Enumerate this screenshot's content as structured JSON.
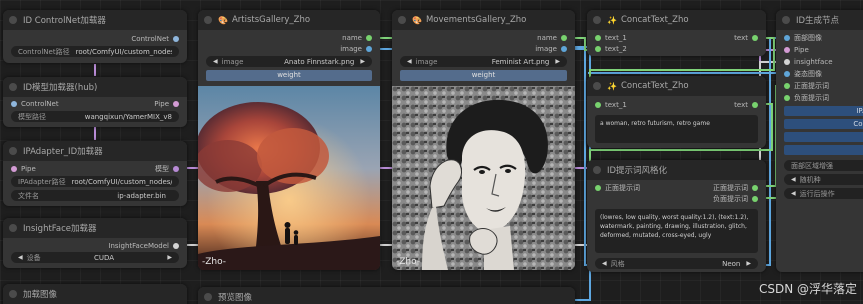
{
  "colors": {
    "port_controlnet": "#8fb6dc",
    "port_image": "#5fa5d8",
    "port_string": "#78d26e",
    "port_pipe": "#d39bd4",
    "port_model": "#e0c28a",
    "port_insightface": "#d4d4d4",
    "wire_blue": "#5ea7e0",
    "wire_green": "#7fd37a",
    "wire_purple": "#b88bd6"
  },
  "nodes": {
    "controlnet_loader": {
      "title": "ID ControlNet加载器",
      "output": "ControlNet",
      "path_label": "ControlNet路径",
      "path_value": "root/ComfyUI/custom_nodes/Com"
    },
    "model_loader": {
      "title": "ID模型加载器(hub)",
      "input": "ControlNet",
      "output": "Pipe",
      "path_label": "模型路径",
      "path_value": "wangqixun/YamerMIX_v8"
    },
    "ipadapter_loader": {
      "title": "IPAdapter_ID加载器",
      "input": "Pipe",
      "output": "模型",
      "path_label": "IPAdapter路径",
      "path_value": "root/ComfyUI/custom_nodes/Com",
      "file_label": "文件名",
      "file_value": "ip-adapter.bin"
    },
    "insightface_loader": {
      "title": "InsightFace加载器",
      "output": "InsightFaceModel",
      "device_label": "设备",
      "device_value": "CUDA"
    },
    "load_image": {
      "title": "加载图像"
    },
    "artists_gallery": {
      "title": "ArtistsGallery_Zho",
      "out_name": "name",
      "out_image": "image",
      "image_label": "image",
      "image_value": "Anato Finnstark.png",
      "weight_label": "weight",
      "image_caption": "-Zho-"
    },
    "movements_gallery": {
      "title": "MovementsGallery_Zho",
      "out_name": "name",
      "out_image": "image",
      "image_label": "image",
      "image_value": "Feminist Art.png",
      "weight_label": "weight",
      "image_caption": "-Zho-"
    },
    "preview_image": {
      "title": "预览图像"
    },
    "concat_text_1": {
      "title": "ConcatText_Zho",
      "in1": "text_1",
      "in2": "text_2",
      "output": "text"
    },
    "concat_text_2": {
      "title": "ConcatText_Zho",
      "in1": "text_1",
      "output": "text",
      "text_value": "a woman, retro futurism, retro game"
    },
    "id_prompt_style": {
      "title": "ID提示词风格化",
      "in1": "正面提示词",
      "out1": "正面提示词",
      "out2": "负面提示词",
      "negative_text": "(lowres, low quality, worst quality:1.2), (text:1.2), watermark, painting, drawing, illustration, glitch, deformed, mutated, cross-eyed, ugly",
      "style_label": "风格",
      "style_value": "Neon"
    },
    "id_generate": {
      "title": "ID生成节点",
      "in_image": "面部图像",
      "in_pipe": "Pipe",
      "in_insightface": "insightface",
      "in_pose": "姿态图像",
      "in_pos": "正面提示词",
      "in_neg": "负面提示词",
      "btn1": "IPA",
      "btn2": "Con",
      "area_label": "面部区域增强",
      "seed_label": "随机种",
      "control_label": "运行后操作"
    }
  },
  "footer": {
    "watermark": "CSDN @浮华落定"
  }
}
